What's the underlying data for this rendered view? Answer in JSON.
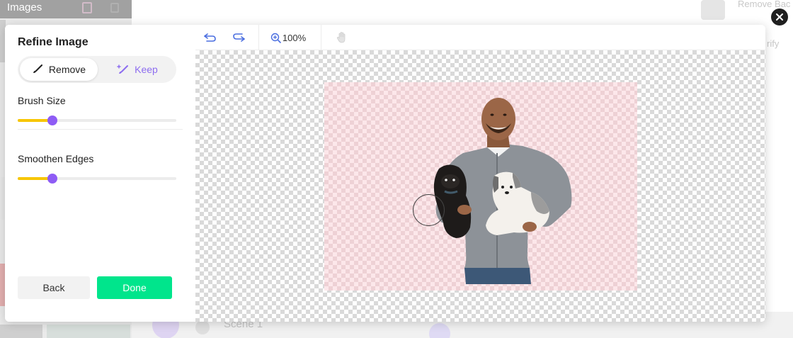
{
  "background": {
    "images_label": "Images",
    "scene_label": "Scene 1",
    "right_label_top": "Remove Bac",
    "right_label_mid": "rify"
  },
  "modal": {
    "title": "Refine Image",
    "modes": [
      {
        "label": "Remove",
        "icon": "brush-remove-icon",
        "selected": true
      },
      {
        "label": "Keep",
        "icon": "brush-keep-icon",
        "selected": false
      }
    ],
    "brush_size": {
      "label": "Brush Size",
      "value": 0.22
    },
    "smoothen_edges": {
      "label": "Smoothen Edges",
      "value": 0.22
    },
    "back_label": "Back",
    "done_label": "Done"
  },
  "toolbar": {
    "zoom_label": "100%",
    "tools": [
      "undo-icon",
      "redo-icon",
      "zoom-icon",
      "hand-icon"
    ]
  },
  "colors": {
    "accent_purple": "#8e5cf5",
    "slider_yellow": "#f7c600",
    "done_green": "#00e58c",
    "keep_purple": "#8d6df0"
  }
}
